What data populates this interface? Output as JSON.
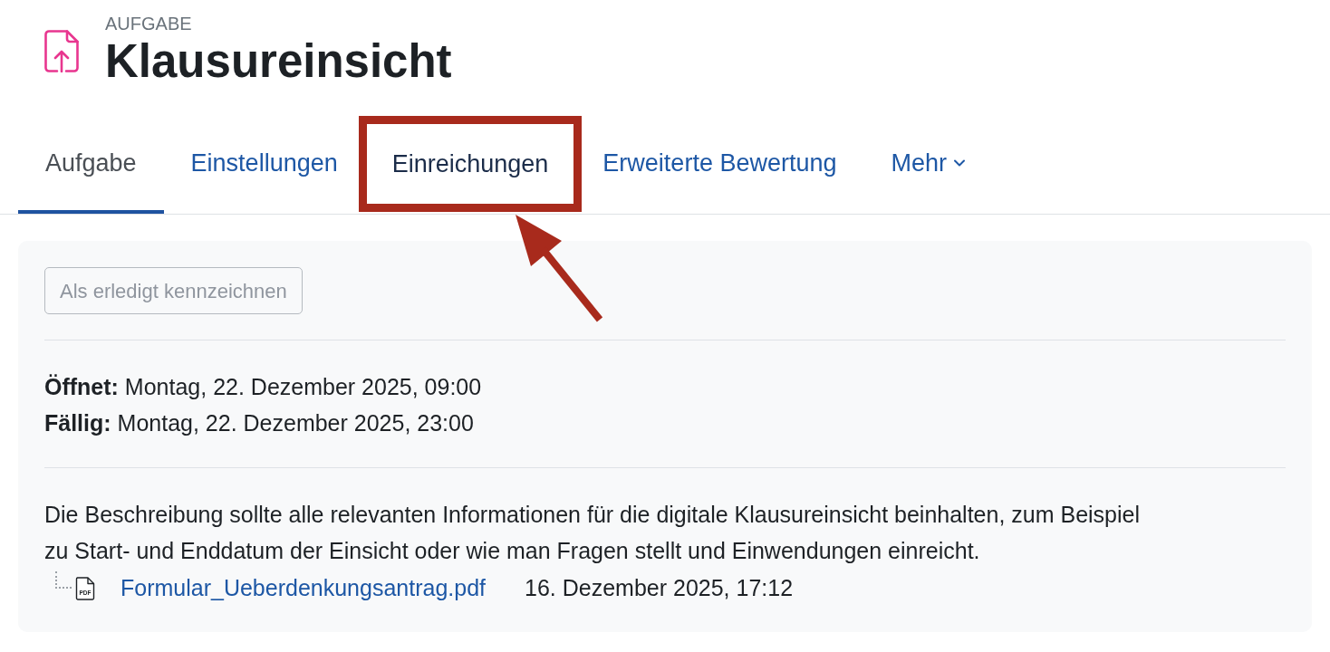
{
  "header": {
    "module_type": "AUFGABE",
    "title": "Klausureinsicht"
  },
  "tabs": [
    {
      "label": "Aufgabe",
      "kind": "tab",
      "selected": true,
      "highlighted": false
    },
    {
      "label": "Einstellungen",
      "kind": "tab",
      "selected": false,
      "highlighted": false
    },
    {
      "label": "Einreichungen",
      "kind": "tab",
      "selected": false,
      "highlighted": true
    },
    {
      "label": "Erweiterte Bewertung",
      "kind": "tab",
      "selected": false,
      "highlighted": false
    },
    {
      "label": "Mehr",
      "kind": "dropdown",
      "selected": false,
      "highlighted": false
    }
  ],
  "completion_button": {
    "label": "Als erledigt kennzeichnen",
    "disabled": true
  },
  "dates": [
    {
      "label": "Öffnet:",
      "value": "Montag, 22. Dezember 2025, 09:00"
    },
    {
      "label": "Fällig:",
      "value": "Montag, 22. Dezember 2025, 23:00"
    }
  ],
  "description": "Die Beschreibung sollte alle relevanten Informationen für die digitale Klausureinsicht beinhalten, zum Beispiel zu Start- und Enddatum der Einsicht oder wie man Fragen stellt und Einwendungen einreicht.",
  "attachments": [
    {
      "file_type": "PDF",
      "name": "Formular_Ueberdenkungsantrag.pdf",
      "date": "16. Dezember 2025, 17:12"
    }
  ]
}
